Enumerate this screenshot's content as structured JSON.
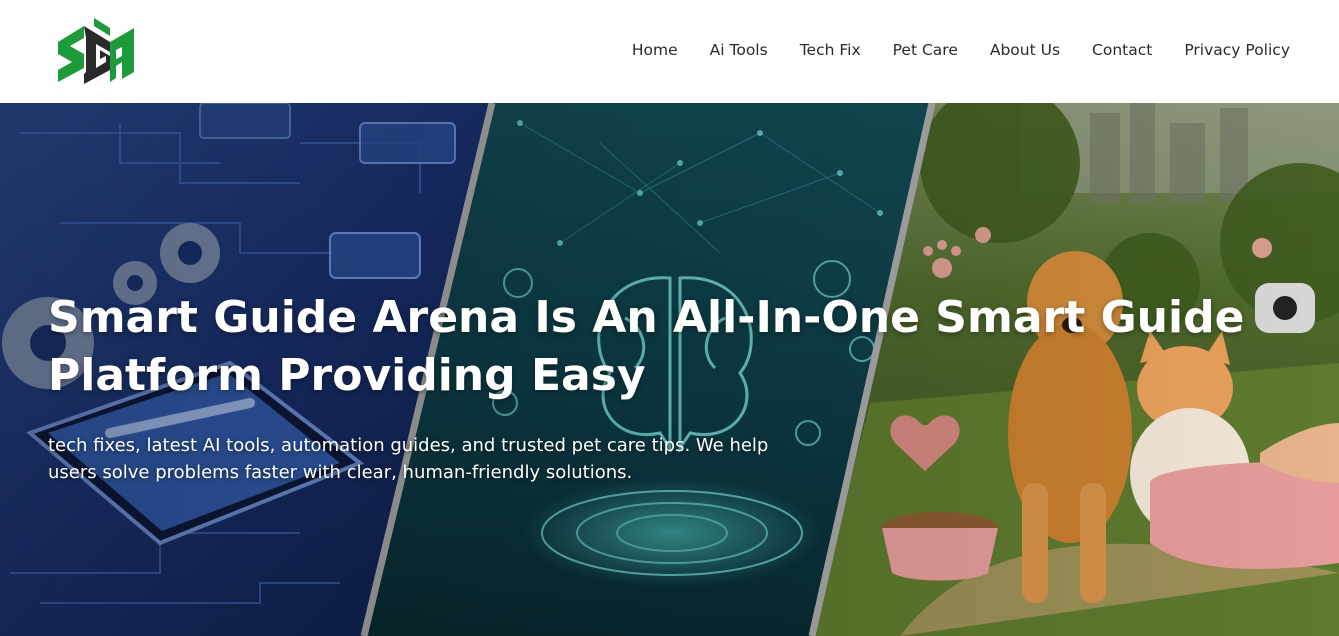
{
  "site": {
    "logo_text": "SGA"
  },
  "nav": {
    "items": [
      {
        "label": "Home"
      },
      {
        "label": "Ai Tools"
      },
      {
        "label": "Tech Fix"
      },
      {
        "label": "Pet Care"
      },
      {
        "label": "About Us"
      },
      {
        "label": "Contact"
      },
      {
        "label": "Privacy Policy"
      }
    ]
  },
  "hero": {
    "title": "Smart Guide Arena Is An All-In-One Smart Guide Platform Providing Easy",
    "subtitle": "tech fixes, latest AI tools, automation guides, and trusted pet care tips. We help users solve problems faster with clear, human-friendly solutions.",
    "panels": [
      {
        "theme": "tech-fix",
        "icon": "gear-icon"
      },
      {
        "theme": "ai-tools",
        "icon": "brain-icon"
      },
      {
        "theme": "pet-care",
        "icon": "paw-icon"
      }
    ]
  },
  "colors": {
    "header_bg": "#ffffff",
    "nav_text": "#2b2b2b",
    "logo_green": "#1f9a3a",
    "logo_dark": "#2a2a2a",
    "panel_tech": "#1c3a7a",
    "panel_ai": "#0f4a52",
    "panel_pet": "#5a6b2a",
    "divider": "#a8a8a8",
    "hero_text": "#ffffff"
  }
}
